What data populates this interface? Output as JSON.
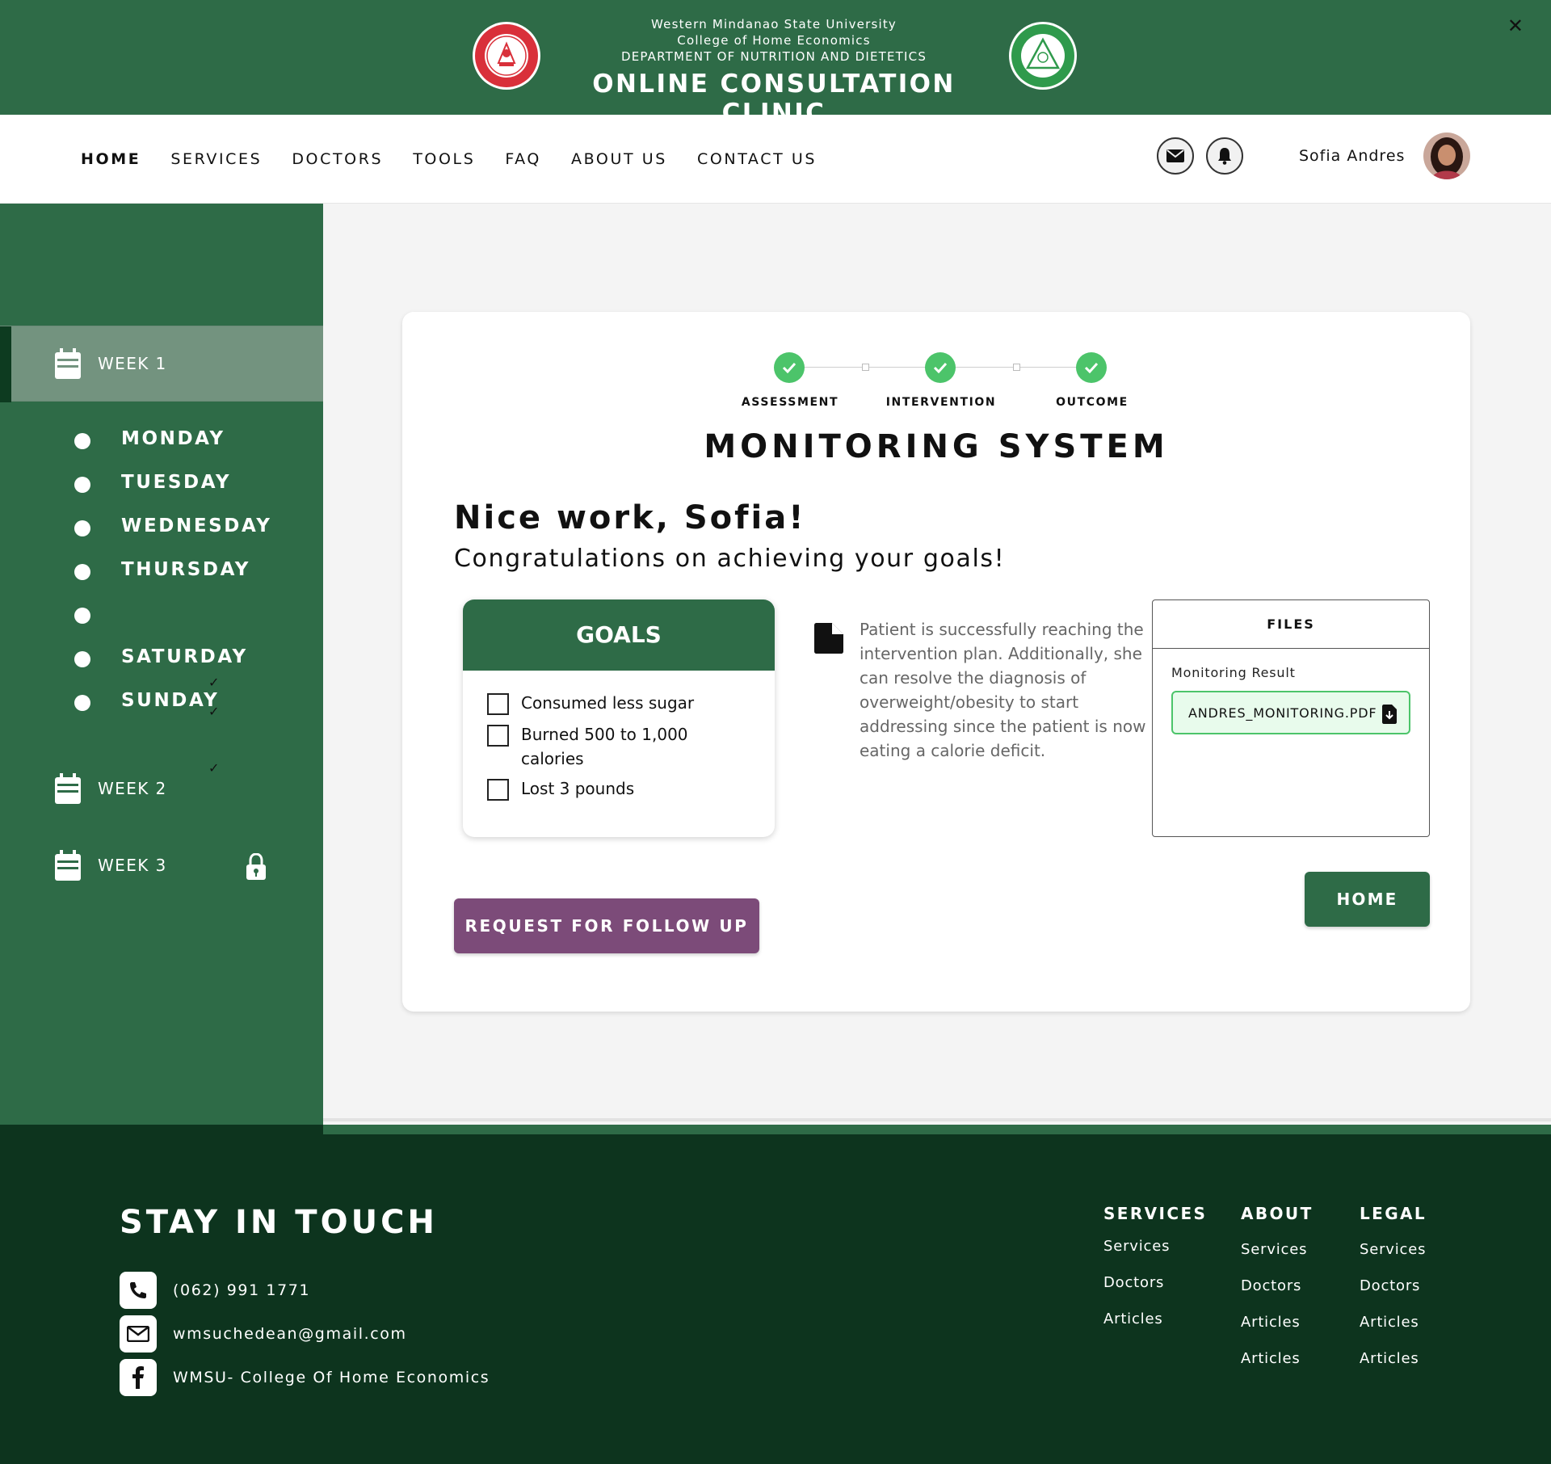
{
  "header": {
    "university": "Western Mindanao State University",
    "college": "College of Home Economics",
    "department": "DEPARTMENT OF NUTRITION AND DIETETICS",
    "title": "ONLINE CONSULTATION CLINIC",
    "left_seal_icon": "wmsu-seal-icon",
    "right_seal_icon": "college-home-economics-seal-icon",
    "close_icon": "close-icon"
  },
  "nav": {
    "items": [
      "HOME",
      "SERVICES",
      "DOCTORS",
      "TOOLS",
      "FAQ",
      "ABOUT US",
      "CONTACT US"
    ],
    "active": "HOME",
    "mail_icon": "mail-icon",
    "bell_icon": "bell-icon",
    "user_name": "Sofia Andres"
  },
  "sidebar": {
    "weeks": [
      {
        "label": "WEEK 1",
        "active": true
      },
      {
        "label": "WEEK 2",
        "active": false
      },
      {
        "label": "WEEK 3",
        "active": false,
        "locked": true
      }
    ],
    "days": [
      "MONDAY",
      "TUESDAY",
      "WEDNESDAY",
      "THURSDAY",
      "",
      "SATURDAY",
      "SUNDAY"
    ],
    "tick_mark": "✓"
  },
  "stepper": {
    "steps": [
      "ASSESSMENT",
      "INTERVENTION",
      "OUTCOME"
    ],
    "completed": 3
  },
  "main": {
    "title": "MONITORING SYSTEM",
    "greeting": "Nice work, Sofia!",
    "subtitle": "Congratulations on achieving your goals!",
    "goals_title": "GOALS",
    "goals": [
      "Consumed less sugar",
      "Burned 500 to 1,000 calories",
      "Lost 3 pounds"
    ],
    "note": "Patient is successfully reaching the intervention plan. Additionally, she can resolve the diagnosis of overweight/obesity to start addressing since the patient is now eating a calorie deficit.",
    "files_title": "FILES",
    "files_caption": "Monitoring Result",
    "file_name": "ANDRES_MONITORING.PDF",
    "followup_button": "REQUEST FOR FOLLOW UP",
    "home_button": "HOME"
  },
  "footer": {
    "title": "STAY IN TOUCH",
    "phone": "(062) 991 1771",
    "email": "wmsuchedean@gmail.com",
    "facebook": "WMSU- College Of Home Economics",
    "columns": [
      {
        "title": "SERVICES",
        "links": [
          "Services",
          "Doctors",
          "Articles"
        ]
      },
      {
        "title": "ABOUT",
        "links": [
          "Services",
          "Doctors",
          "Articles",
          "Articles"
        ]
      },
      {
        "title": "LEGAL",
        "links": [
          "Services",
          "Doctors",
          "Articles",
          "Articles"
        ]
      }
    ]
  },
  "colors": {
    "brand_green": "#2e6b47",
    "footer_green": "#0d341e",
    "success_green": "#4cc46a",
    "purple": "#7c4b79"
  }
}
